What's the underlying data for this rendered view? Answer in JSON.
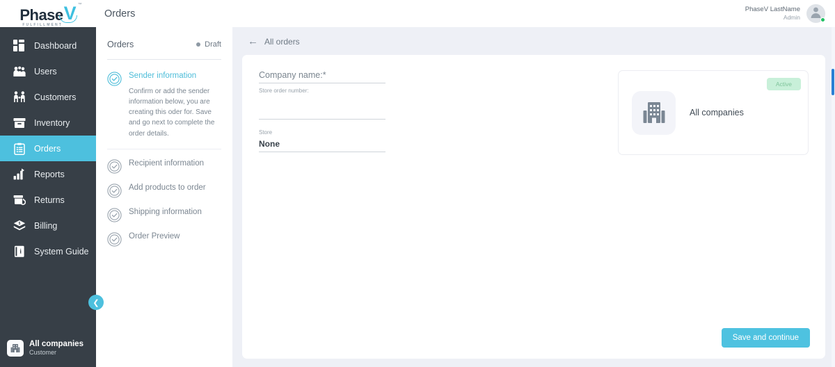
{
  "brand": {
    "name": "Phase",
    "mark": "V",
    "tm": "™",
    "tagline": "FULFILLMENT",
    "accent": "#4dc0de",
    "sidebar_bg": "#373f47"
  },
  "sidebar": {
    "items": [
      {
        "label": "Dashboard",
        "icon": "dashboard-icon",
        "active": false
      },
      {
        "label": "Users",
        "icon": "users-icon",
        "active": false
      },
      {
        "label": "Customers",
        "icon": "customers-icon",
        "active": false
      },
      {
        "label": "Inventory",
        "icon": "inventory-icon",
        "active": false
      },
      {
        "label": "Orders",
        "icon": "orders-icon",
        "active": true
      },
      {
        "label": "Reports",
        "icon": "reports-icon",
        "active": false
      },
      {
        "label": "Returns",
        "icon": "returns-icon",
        "active": false
      },
      {
        "label": "Billing",
        "icon": "billing-icon",
        "active": false
      },
      {
        "label": "System Guide",
        "icon": "system-guide-icon",
        "active": false
      }
    ],
    "collapse_icon": "chevron-left-icon",
    "footer": {
      "name": "All companies",
      "role": "Customer",
      "icon": "building-icon"
    }
  },
  "header": {
    "title": "Orders",
    "user": {
      "name": "PhaseV LastName",
      "role": "Admin",
      "avatar_icon": "avatar-icon",
      "status_color": "#21c063"
    }
  },
  "steps_panel": {
    "title": "Orders",
    "status": {
      "label": "Draft",
      "dot_color": "#8e99a4"
    },
    "steps": [
      {
        "label": "Sender information",
        "active": true,
        "description": "Confirm or add the sender information below, you are creating this oder for. Save and go next to complete the order details."
      },
      {
        "label": "Recipient information",
        "active": false,
        "description": ""
      },
      {
        "label": "Add products to order",
        "active": false,
        "description": ""
      },
      {
        "label": "Shipping information",
        "active": false,
        "description": ""
      },
      {
        "label": "Order Preview",
        "active": false,
        "description": ""
      }
    ]
  },
  "main": {
    "back_link": "All orders",
    "back_icon": "arrow-left-icon",
    "form": {
      "company_name": {
        "label": "Company name:*",
        "value": "",
        "placeholder": ""
      },
      "store_order_number": {
        "label": "Store order number:",
        "value": "",
        "placeholder": ""
      },
      "store": {
        "label": "Store",
        "value": "None",
        "placeholder": ""
      }
    },
    "company_card": {
      "badge": "Active",
      "badge_bg": "#c8f0d9",
      "badge_color": "#7fc49b",
      "icon": "building-icon",
      "name": "All companies"
    },
    "save_button": "Save and continue"
  }
}
